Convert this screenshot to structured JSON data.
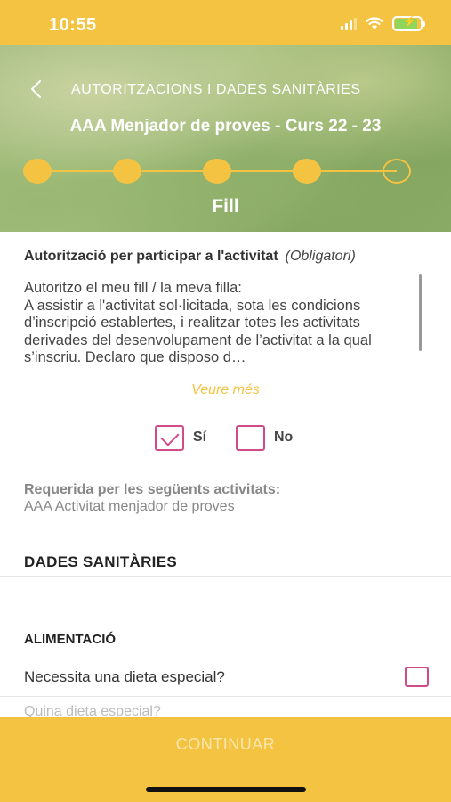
{
  "status_bar": {
    "time": "10:55",
    "icons": [
      "cellular-signal-icon",
      "wifi-icon",
      "battery-charging-icon"
    ]
  },
  "header": {
    "back_icon": "chevron-left-icon",
    "title": "AUTORITZACIONS I DADES SANITÀRIES",
    "subtitle": "AAA Menjador de proves - Curs 22 - 23",
    "stepper": {
      "total_steps": 5,
      "completed_steps": 4
    },
    "step_label": "Fill"
  },
  "authorization": {
    "heading": "Autorització per participar a l'activitat",
    "required_tag": "(Obligatori)",
    "text": "Autoritzo el meu fill / la meva filla:\nA assistir a l'activitat sol·licitada, sota  les condicions d’inscripció establertes, i realitzar totes les activitats derivades del desenvolupament de l’activitat a la qual s’inscriu. Declaro que disposo d…",
    "see_more": "Veure més",
    "option_yes": "Sí",
    "option_no": "No",
    "selected": "Sí",
    "required_label": "Requerida per les següents activitats:",
    "required_activity": "AAA Activitat menjador de proves"
  },
  "health": {
    "section_title": "DADES SANITÀRIES",
    "food_title": "ALIMENTACIÓ",
    "special_diet_question": "Necessita una dieta especial?",
    "special_diet_checked": false,
    "which_diet_label": "Quina dieta especial?"
  },
  "footer": {
    "continue_label": "CONTINUAR"
  },
  "colors": {
    "accent": "#f5c342",
    "checkbox": "#d14b8a",
    "text": "#333333",
    "muted": "#888888"
  }
}
